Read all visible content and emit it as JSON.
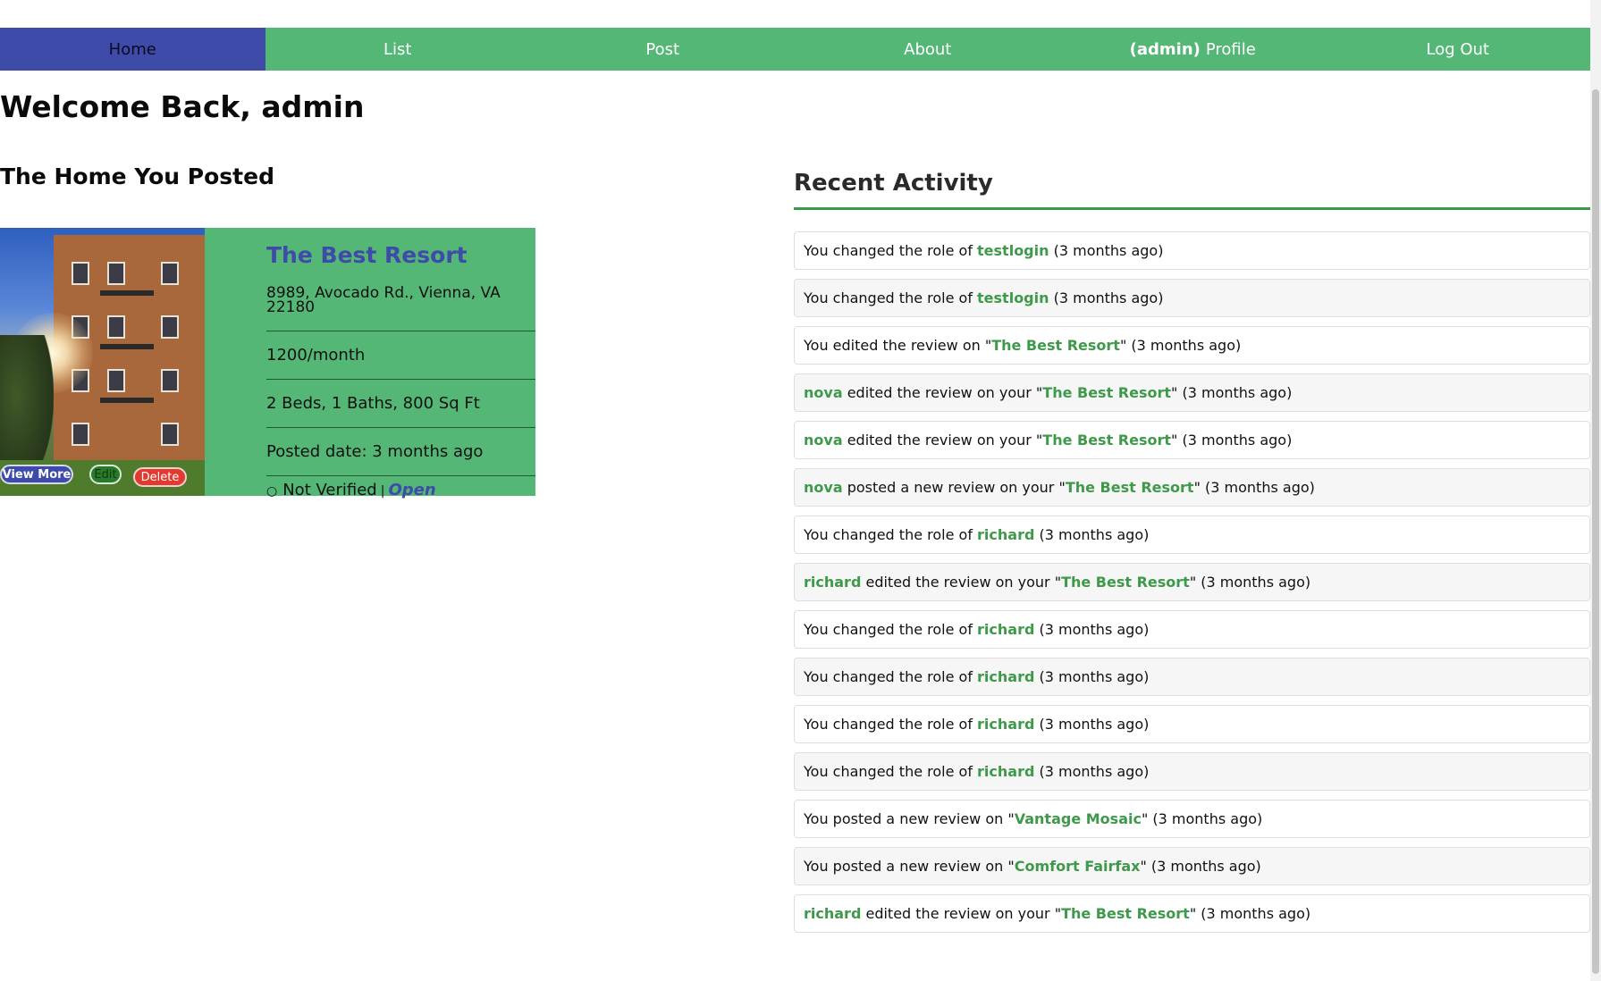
{
  "nav": {
    "items": [
      {
        "label": "Home",
        "active": true
      },
      {
        "label": "List",
        "active": false
      },
      {
        "label": "Post",
        "active": false
      },
      {
        "label": "About",
        "active": false
      },
      {
        "label": "Profile",
        "prefix": "(admin)",
        "active": false
      },
      {
        "label": "Log Out",
        "active": false
      }
    ]
  },
  "welcome": "Welcome Back, admin",
  "posted_heading": "The Home You Posted",
  "card": {
    "title": "The Best Resort",
    "address": "8989, Avocado Rd., Vienna, VA 22180",
    "price": "1200/month",
    "details": "2 Beds, 1 Baths, 800 Sq Ft",
    "posted": "Posted date: 3 months ago",
    "verify_icon": "○",
    "verify": "Not Verified",
    "separator": "|",
    "status": "Open",
    "buttons": {
      "view": "View More",
      "edit": "Edit",
      "delete": "Delete"
    }
  },
  "activity": {
    "title": "Recent Activity",
    "items": [
      {
        "pre": "You changed the role of ",
        "link": "testlogin",
        "post": " (3 months ago)"
      },
      {
        "pre": "You changed the role of ",
        "link": "testlogin",
        "post": " (3 months ago)"
      },
      {
        "pre": "You edited the review on \"",
        "link": "The Best Resort",
        "post": "\" (3 months ago)"
      },
      {
        "link": "nova",
        "mid": " edited the review on your \"",
        "link2": "The Best Resort",
        "post": "\" (3 months ago)"
      },
      {
        "link": "nova",
        "mid": " edited the review on your \"",
        "link2": "The Best Resort",
        "post": "\" (3 months ago)"
      },
      {
        "link": "nova",
        "mid": " posted a new review on your \"",
        "link2": "The Best Resort",
        "post": "\" (3 months ago)"
      },
      {
        "pre": "You changed the role of ",
        "link": "richard",
        "post": " (3 months ago)"
      },
      {
        "link": "richard",
        "mid": " edited the review on your \"",
        "link2": "The Best Resort",
        "post": "\" (3 months ago)"
      },
      {
        "pre": "You changed the role of ",
        "link": "richard",
        "post": " (3 months ago)"
      },
      {
        "pre": "You changed the role of ",
        "link": "richard",
        "post": " (3 months ago)"
      },
      {
        "pre": "You changed the role of ",
        "link": "richard",
        "post": " (3 months ago)"
      },
      {
        "pre": "You changed the role of ",
        "link": "richard",
        "post": " (3 months ago)"
      },
      {
        "pre": "You posted a new review on \"",
        "link": "Vantage Mosaic",
        "post": "\" (3 months ago)"
      },
      {
        "pre": "You posted a new review on \"",
        "link": "Comfort Fairfax",
        "post": "\" (3 months ago)"
      },
      {
        "link": "richard",
        "mid": " edited the review on your \"",
        "link2": "The Best Resort",
        "post": "\" (3 months ago)"
      }
    ]
  },
  "colors": {
    "nav_green": "#54b776",
    "nav_active": "#3f4ba8",
    "link_green": "#3e9a4a",
    "delete_red": "#e23a2e"
  }
}
